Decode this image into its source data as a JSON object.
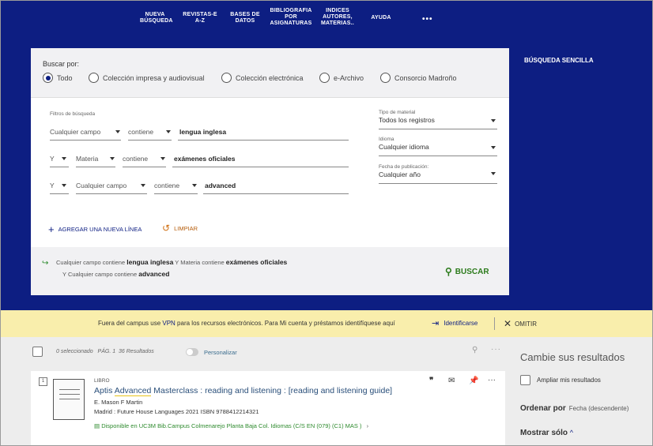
{
  "nav": {
    "items": [
      {
        "label": "NUEVA\nBÚSQUEDA"
      },
      {
        "label": "REVISTAS-E\nA-Z"
      },
      {
        "label": "BASES DE\nDATOS"
      },
      {
        "label": "BIBLIOGRAFIA\nPOR\nASIGNATURAS"
      },
      {
        "label": "INDICES\nAUTORES,\nMATERIAS.."
      },
      {
        "label": "AYUDA"
      }
    ],
    "more": "•••",
    "simple_search": "BÚSQUEDA SENCILLA"
  },
  "search": {
    "buscar_por": "Buscar por:",
    "scopes": [
      {
        "label": "Todo",
        "selected": true
      },
      {
        "label": "Colección impresa y audiovisual",
        "selected": false
      },
      {
        "label": "Colección electrónica",
        "selected": false
      },
      {
        "label": "e-Archivo",
        "selected": false
      },
      {
        "label": "Consorcio Madroño",
        "selected": false
      }
    ],
    "filters_title": "Filtros de búsqueda",
    "rows": [
      {
        "bool": "",
        "field": "Cualquier campo",
        "op": "contiene",
        "value": "lengua inglesa"
      },
      {
        "bool": "Y",
        "field": "Materia",
        "op": "contiene",
        "value": "exámenes oficiales"
      },
      {
        "bool": "Y",
        "field": "Cualquier campo",
        "op": "contiene",
        "value": "advanced"
      }
    ],
    "side_filters": [
      {
        "label": "Tipo de material",
        "value": "Todos los registros"
      },
      {
        "label": "Idioma",
        "value": "Cualquier idioma"
      },
      {
        "label": "Fecha de publicación:",
        "value": "Cualquier año"
      }
    ],
    "add_line": "AGREGAR UNA NUEVA LÍNEA",
    "clear": "LIMPIAR",
    "summary": {
      "l1_a": "Cualquier campo",
      "l1_b": "contiene",
      "l1_c": "lengua inglesa",
      "l1_d": "Y",
      "l1_e": "Materia",
      "l1_f": "contiene",
      "l1_g": "exámenes oficiales",
      "l2_a": "Y",
      "l2_b": "Cualquier campo",
      "l2_c": "contiene",
      "l2_d": "advanced"
    },
    "button": "BUSCAR"
  },
  "banner": {
    "pre": "Fuera del campus use ",
    "vpn": "VPN",
    "post": " para los recursos electrónicos. Para Mi cuenta y préstamos identifíquese aquí",
    "identify": "Identificarse",
    "omit": "OMITIR"
  },
  "results": {
    "selected": "0 seleccionado",
    "page": "PÁG. 1",
    "count": "36 Resultados",
    "personalize": "Personalizar",
    "items": [
      {
        "num": "1",
        "type": "LIBRO",
        "title_pre": "Aptis ",
        "title_hl": "Advanced",
        "title_post": " Masterclass : reading and listening : [reading and listening guide]",
        "author": "E. Mason F Martin",
        "pub": "Madrid : Future House Languages 2021 ISBN 9788412214321",
        "avail_status": "Disponible en",
        "avail_loc": "UC3M Bib.Campus Colmenarejo  Planta Baja Col. Idiomas (C/S EN (079) (C1) MAS )",
        "chevron": "›"
      }
    ]
  },
  "refine": {
    "title": "Cambie sus resultados",
    "expand": "Ampliar mis resultados",
    "order_label": "Ordenar por",
    "order_value": "Fecha (descendente)",
    "show_only": "Mostrar sólo",
    "show_chevron": "^"
  },
  "colors": {
    "navy": "#0d1e82",
    "banner": "#f9eeac",
    "link": "#2a4f7a",
    "available": "#2d8a2d"
  }
}
